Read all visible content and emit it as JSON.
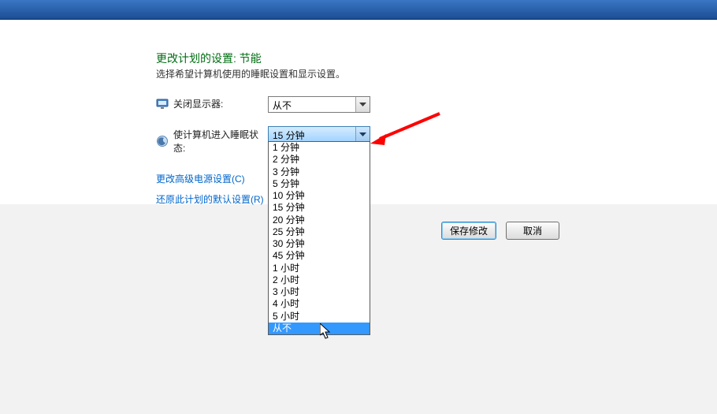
{
  "header": {
    "title": "更改计划的设置: 节能",
    "subtitle": "选择希望计算机使用的睡眠设置和显示设置。"
  },
  "rows": {
    "display_off": {
      "label": "关闭显示器:",
      "value": "从不"
    },
    "sleep": {
      "label": "使计算机进入睡眠状态:",
      "value": "15 分钟"
    }
  },
  "links": {
    "advanced": "更改高级电源设置(C)",
    "restore": "还原此计划的默认设置(R)"
  },
  "dropdown": {
    "options": [
      "1 分钟",
      "2 分钟",
      "3 分钟",
      "5 分钟",
      "10 分钟",
      "15 分钟",
      "20 分钟",
      "25 分钟",
      "30 分钟",
      "45 分钟",
      "1 小时",
      "2 小时",
      "3 小时",
      "4 小时",
      "5 小时",
      "从不"
    ],
    "highlighted": "从不"
  },
  "buttons": {
    "save": "保存修改",
    "cancel": "取消"
  }
}
